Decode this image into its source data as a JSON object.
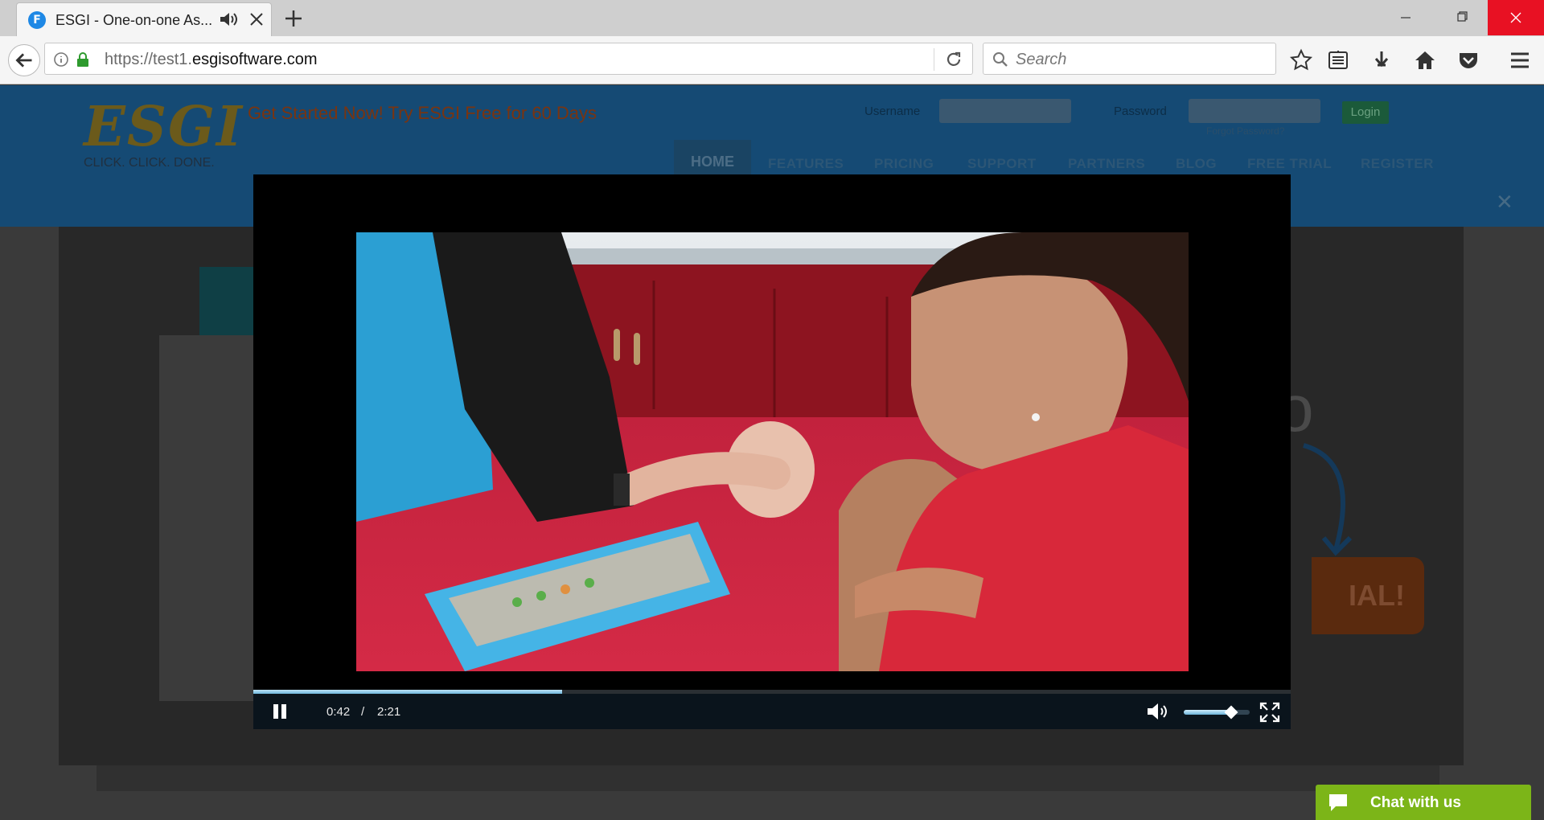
{
  "browser": {
    "tab_title": "ESGI - One-on-one As...",
    "favicon_letter": "F",
    "url_prefix": "https://test1.",
    "url_domain": "esgisoftware.com",
    "search_placeholder": "Search"
  },
  "site": {
    "logo": "ESGI",
    "tagline": "CLICK. CLICK. DONE.",
    "promo": "Get Started Now! Try ESGI Free for 60 Days",
    "username_label": "Username",
    "password_label": "Password",
    "login_button": "Login",
    "forgot_link": "Forgot Password?",
    "nav": [
      "HOME",
      "FEATURES",
      "PRICING",
      "SUPPORT",
      "PARTNERS",
      "BLOG",
      "FREE TRIAL",
      "REGISTER"
    ],
    "close_symbol": "✕",
    "hero_glyph": "o",
    "hero_cta": "IAL!"
  },
  "video": {
    "current_time": "0:42",
    "separator": "/",
    "duration": "2:21",
    "progress_fraction": 0.298,
    "volume_fraction": 0.72,
    "accent_color": "#6fb8de"
  },
  "chat": {
    "label": "Chat with us",
    "color": "#7cb518"
  }
}
